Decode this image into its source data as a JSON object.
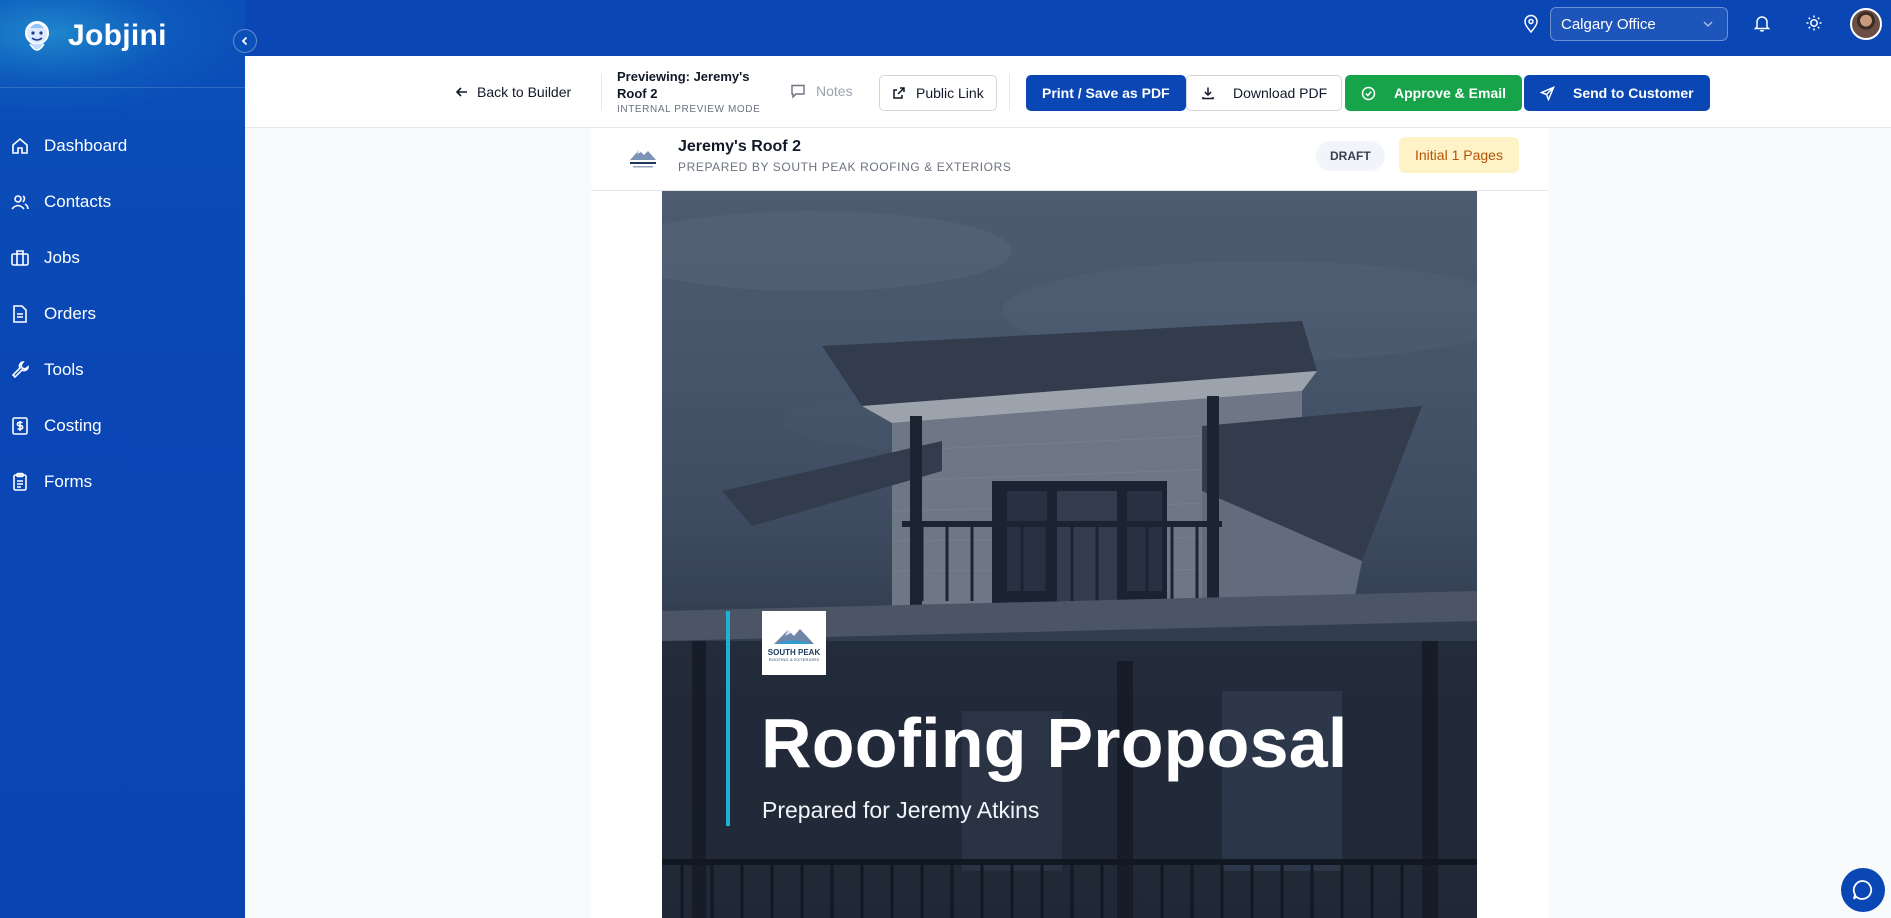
{
  "app": {
    "name": "Jobjini"
  },
  "sidebar": {
    "items": [
      {
        "label": "Dashboard",
        "icon": "home-icon"
      },
      {
        "label": "Contacts",
        "icon": "users-icon"
      },
      {
        "label": "Jobs",
        "icon": "briefcase-icon"
      },
      {
        "label": "Orders",
        "icon": "document-icon"
      },
      {
        "label": "Tools",
        "icon": "wrench-icon"
      },
      {
        "label": "Costing",
        "icon": "dollar-icon"
      },
      {
        "label": "Forms",
        "icon": "clipboard-icon"
      }
    ]
  },
  "topbar": {
    "office": "Calgary Office"
  },
  "toolbar": {
    "back_label": "Back to Builder",
    "preview_title": "Previewing: Jeremy's Roof 2",
    "preview_mode": "INTERNAL PREVIEW MODE",
    "notes_label": "Notes",
    "public_link_label": "Public Link",
    "print_label": "Print / Save as PDF",
    "download_label": "Download PDF",
    "approve_label": "Approve & Email",
    "send_label": "Send to Customer"
  },
  "document": {
    "title": "Jeremy's Roof 2",
    "subtitle": "PREPARED BY SOUTH PEAK ROOFING & EXTERIORS",
    "status_badge": "DRAFT",
    "pages_badge": "Initial 1 Pages"
  },
  "cover": {
    "logo_text": "SOUTH PEAK",
    "logo_subtext": "ROOFING & EXTERIORS",
    "title": "Roofing Proposal",
    "subtitle": "Prepared for Jeremy Atkins"
  },
  "colors": {
    "brand_blue": "#0a47b5",
    "approve_green": "#16a34a",
    "accent_cyan": "#22b1d6",
    "pages_badge_bg": "#fef3c7"
  }
}
